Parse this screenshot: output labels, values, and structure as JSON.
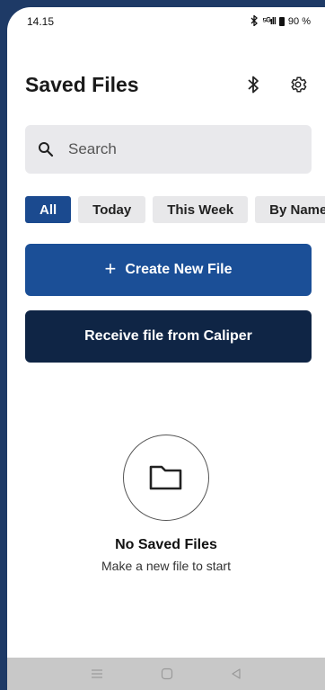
{
  "status_bar": {
    "time": "14.15",
    "network": "⁵ᴳ",
    "battery": "90 %"
  },
  "header": {
    "title": "Saved Files"
  },
  "search": {
    "placeholder": "Search"
  },
  "filters": [
    "All",
    "Today",
    "This Week",
    "By Name"
  ],
  "actions": {
    "create_label": "Create New File",
    "receive_label": "Receive file from Caliper"
  },
  "empty_state": {
    "title": "No Saved Files",
    "subtitle": "Make a new file to start"
  },
  "colors": {
    "primary": "#1b4f97",
    "dark": "#0f2545",
    "chip_active": "#1b4a8f",
    "chip_inactive": "#e8e8ea"
  }
}
